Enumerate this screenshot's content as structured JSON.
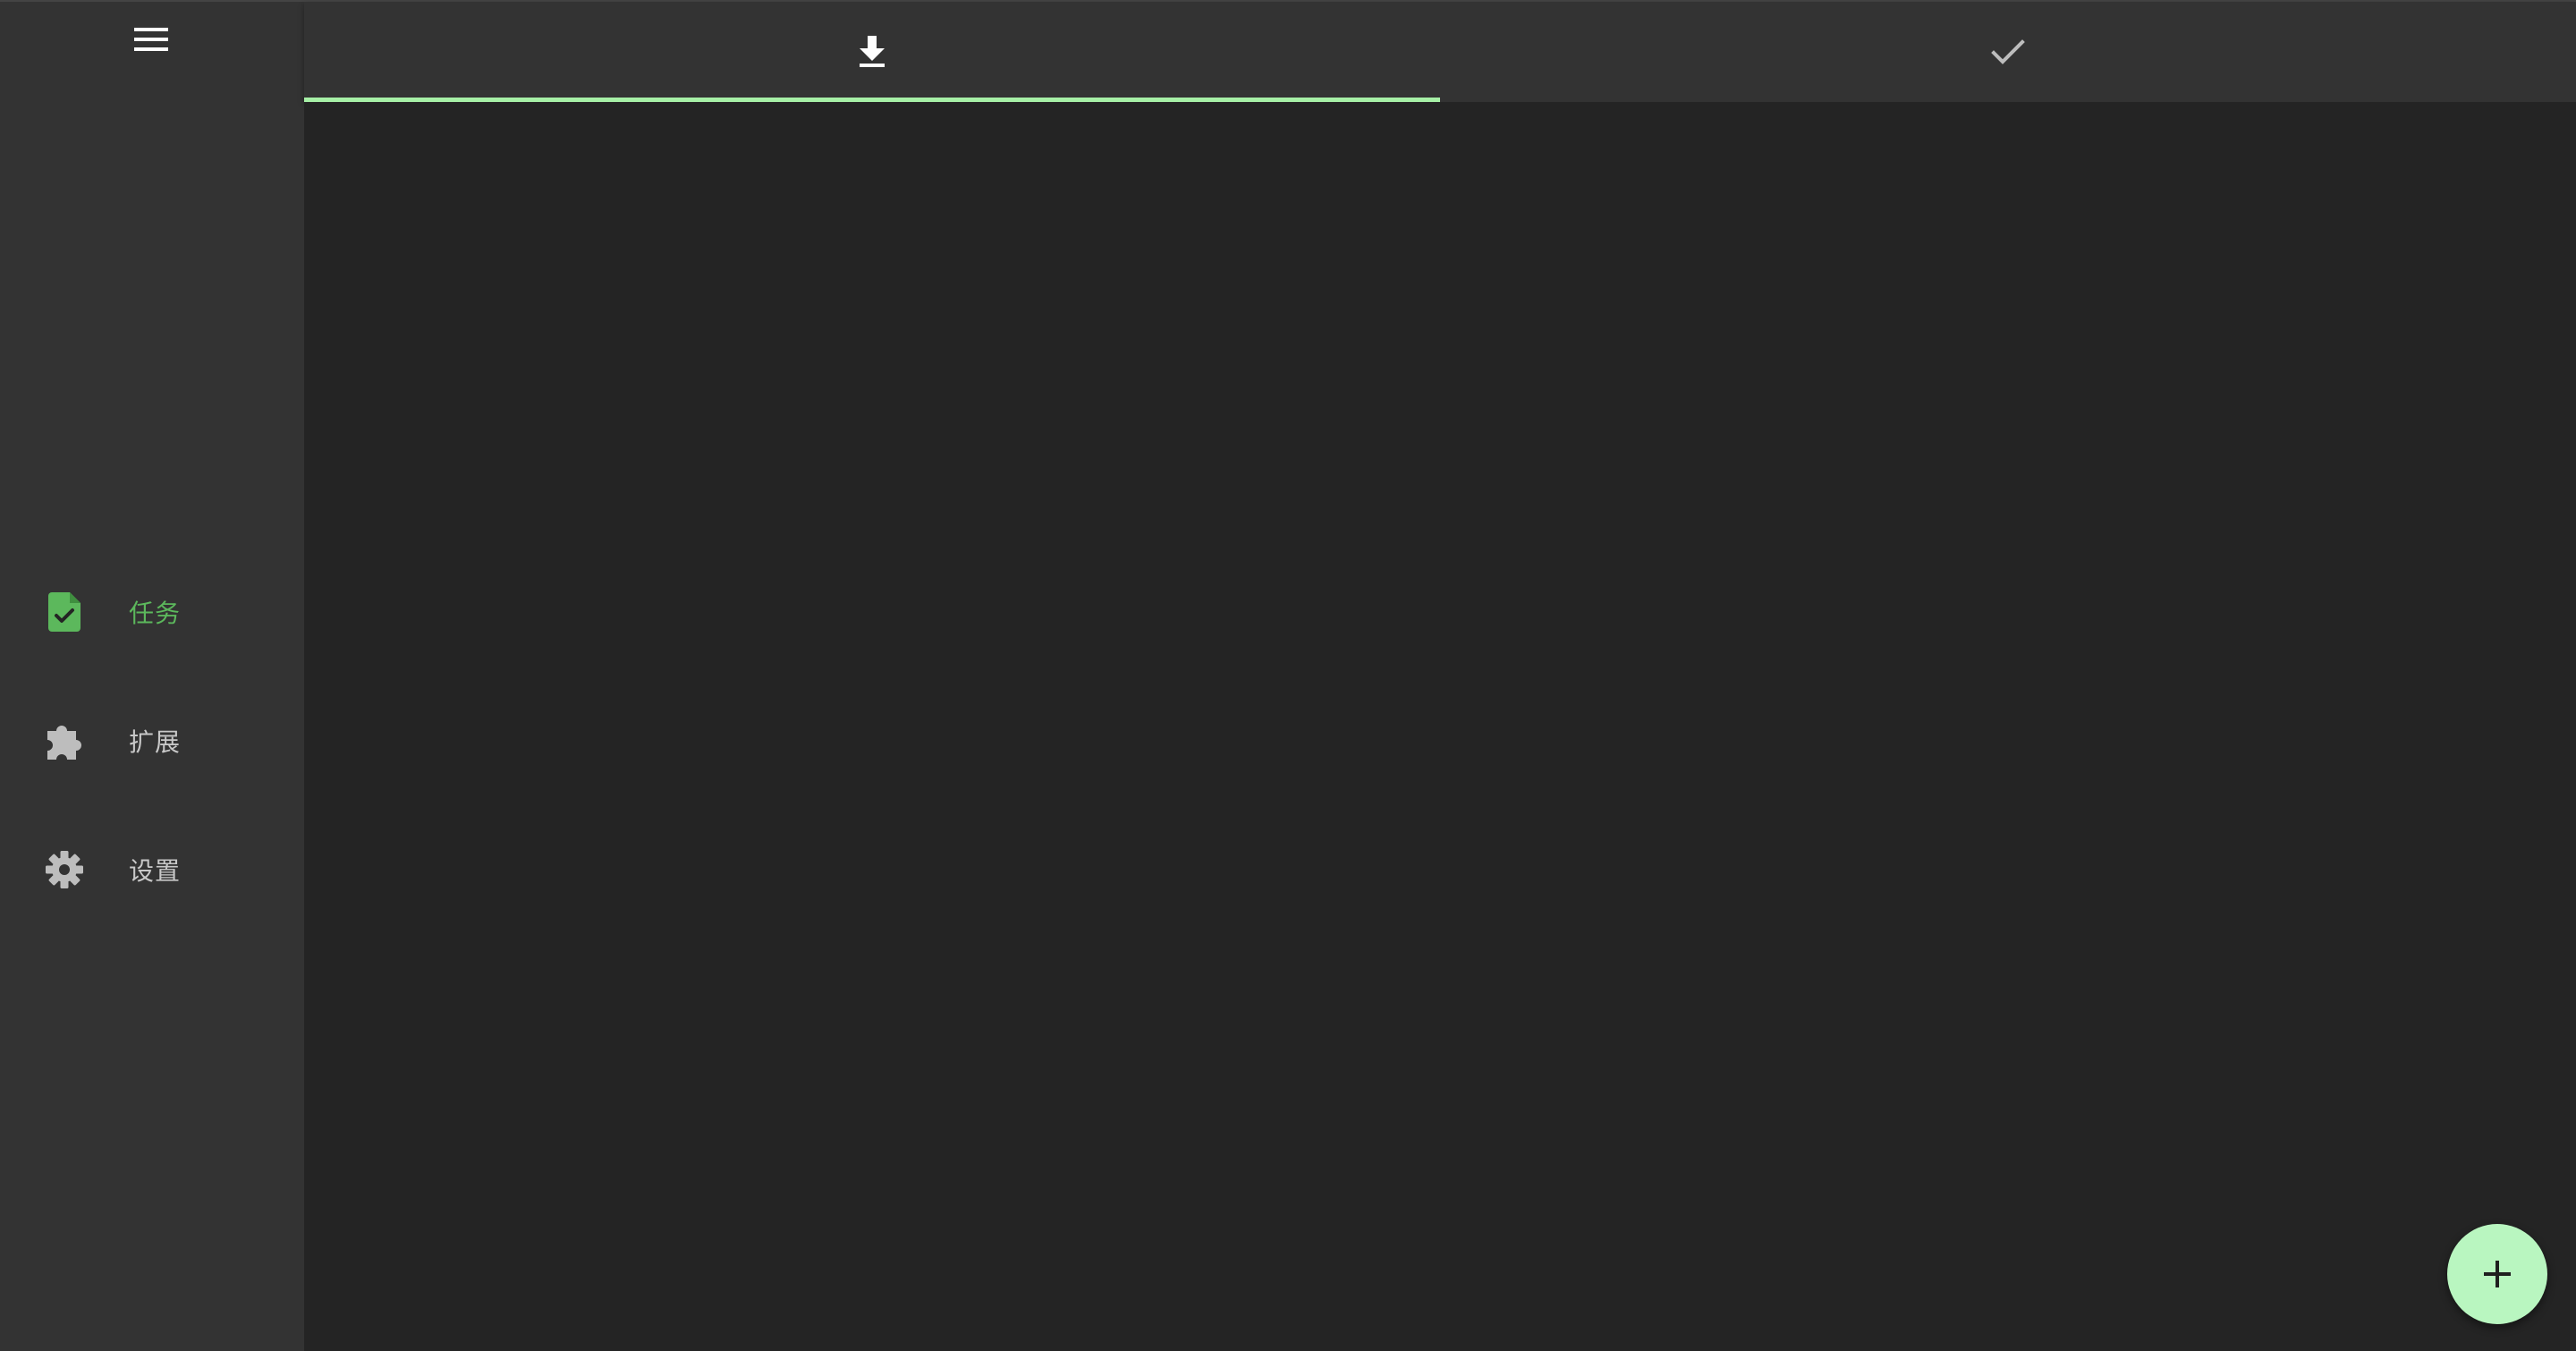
{
  "sidebar": {
    "menu_icon": "menu-icon",
    "items": [
      {
        "label": "任务",
        "icon": "task-file-check-icon",
        "active": true
      },
      {
        "label": "扩展",
        "icon": "puzzle-icon",
        "active": false
      },
      {
        "label": "设置",
        "icon": "gear-icon",
        "active": false
      }
    ]
  },
  "tabs": [
    {
      "icon": "download-icon",
      "active": true
    },
    {
      "icon": "check-icon",
      "active": false
    }
  ],
  "fab": {
    "icon": "plus-icon"
  },
  "colors": {
    "accent": "#5cb85c",
    "tab_indicator": "#a6f0a6",
    "fab_bg": "#b9f6c0",
    "sidebar_bg": "#333333",
    "content_bg": "#242424"
  }
}
